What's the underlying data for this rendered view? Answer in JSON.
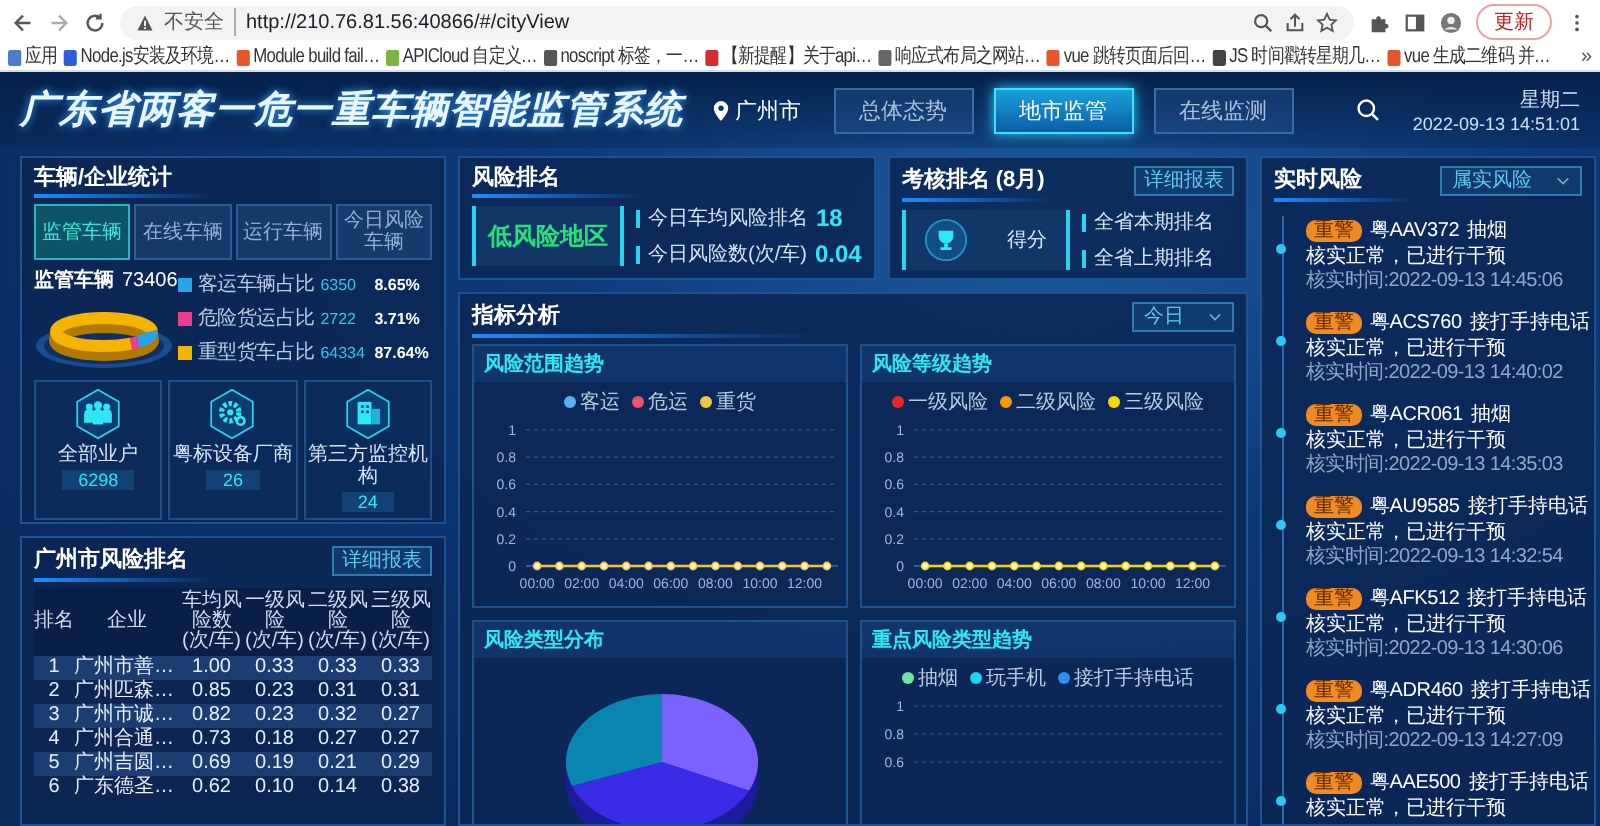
{
  "browser": {
    "security": "不安全",
    "url": "http://210.76.81.56:40866/#/cityView",
    "update_button": "更新"
  },
  "bookmarks": [
    {
      "label": "应用",
      "color": "#4a7bd0"
    },
    {
      "label": "Node.js安装及环境…",
      "color": "#2b5fd9"
    },
    {
      "label": "Module build fail…",
      "color": "#e8542c"
    },
    {
      "label": "APICloud 自定义…",
      "color": "#7cb342"
    },
    {
      "label": "noscript 标签，一…",
      "color": "#555555"
    },
    {
      "label": "【新提醒】关于api…",
      "color": "#d32f2f"
    },
    {
      "label": "响应式布局之网站…",
      "color": "#666666"
    },
    {
      "label": "vue 跳转页面后回…",
      "color": "#e8542d"
    },
    {
      "label": "JS 时间戳转星期几…",
      "color": "#444444"
    },
    {
      "label": "vue 生成二维码 并…",
      "color": "#e8542e"
    }
  ],
  "bookmarks_more": "»",
  "header": {
    "title": "广东省两客一危一重车辆智能监管系统",
    "location": "广州市",
    "nav": [
      {
        "label": "总体态势",
        "selected": false
      },
      {
        "label": "地市监管",
        "selected": true
      },
      {
        "label": "在线监测",
        "selected": false
      }
    ],
    "weekday": "星期二",
    "datetime": "2022-09-13 14:51:01"
  },
  "vehicle_stats": {
    "title": "车辆/企业统计",
    "tabs": [
      {
        "label": "监管车辆",
        "selected": true
      },
      {
        "label": "在线车辆",
        "selected": false
      },
      {
        "label": "运行车辆",
        "selected": false
      },
      {
        "label": "今日风险车辆",
        "selected": false
      }
    ],
    "total_label": "监管车辆",
    "total_value": "73406",
    "legend": [
      {
        "label": "客运车辆占比",
        "count": "6350",
        "percent": "8.65%",
        "color": "#29a3ec"
      },
      {
        "label": "危险货运占比",
        "count": "2722",
        "percent": "3.71%",
        "color": "#e83e8c"
      },
      {
        "label": "重型货车占比",
        "count": "64334",
        "percent": "87.64%",
        "color": "#f5b400"
      }
    ],
    "cards": [
      {
        "kind": "people",
        "label": "全部业户",
        "value": "6298"
      },
      {
        "kind": "gear",
        "label": "粤标设备厂商",
        "value": "26"
      },
      {
        "kind": "building",
        "label": "第三方监控机构",
        "value": "24"
      }
    ]
  },
  "city_ranking": {
    "title": "广州市风险排名",
    "report_button": "详细报表",
    "columns": [
      {
        "label": "排名"
      },
      {
        "label": "企业"
      },
      {
        "label": "车均风险数",
        "unit": "(次/车)"
      },
      {
        "label": "一级风险",
        "unit": "(次/车)"
      },
      {
        "label": "二级风险",
        "unit": "(次/车)"
      },
      {
        "label": "三级风险",
        "unit": "(次/车)"
      }
    ],
    "rows": [
      [
        "1",
        "广州市善…",
        "1.00",
        "0.33",
        "0.33",
        "0.33"
      ],
      [
        "2",
        "广州匹森…",
        "0.85",
        "0.23",
        "0.31",
        "0.31"
      ],
      [
        "3",
        "广州市诚…",
        "0.82",
        "0.23",
        "0.32",
        "0.27"
      ],
      [
        "4",
        "广州合通…",
        "0.73",
        "0.18",
        "0.27",
        "0.27"
      ],
      [
        "5",
        "广州吉圆…",
        "0.69",
        "0.19",
        "0.21",
        "0.29"
      ],
      [
        "6",
        "广东德圣…",
        "0.62",
        "0.10",
        "0.14",
        "0.38"
      ]
    ]
  },
  "risk_rank": {
    "title": "风险排名",
    "level": "低风险地区",
    "stats": [
      {
        "label": "今日车均风险排名",
        "value": "18"
      },
      {
        "label": "今日风险数(次/车)",
        "value": "0.04"
      }
    ]
  },
  "assessment": {
    "title": "考核排名 (8月)",
    "report_button": "详细报表",
    "score_label": "得分",
    "stats": [
      "全省本期排名",
      "全省上期排名"
    ]
  },
  "indicators": {
    "title": "指标分析",
    "period": "今日",
    "charts": [
      {
        "kind": "line",
        "title": "风险范围趋势",
        "chart_data": {
          "type": "line",
          "grid": true,
          "xlim": [
            -0.5,
            13.5
          ],
          "x": [
            0,
            1,
            2,
            3,
            4,
            5,
            6,
            7,
            8,
            9,
            10,
            11,
            12,
            13
          ],
          "xticks": [
            {
              "value": 0,
              "label": "00:00"
            },
            {
              "value": 2,
              "label": "02:00"
            },
            {
              "value": 4,
              "label": "04:00"
            },
            {
              "value": 6,
              "label": "06:00"
            },
            {
              "value": 8,
              "label": "08:00"
            },
            {
              "value": 10,
              "label": "10:00"
            },
            {
              "value": 12,
              "label": "12:00"
            }
          ],
          "ylim": [
            0,
            1
          ],
          "yticks": [
            0,
            0.2,
            0.4,
            0.6,
            0.8,
            1
          ],
          "series": [
            {
              "name": "客运",
              "color": "#5ab1ef",
              "values": [
                null,
                null,
                null,
                null,
                null,
                null,
                null,
                null,
                null,
                null,
                null,
                null,
                null,
                null
              ]
            },
            {
              "name": "危运",
              "color": "#e8566b",
              "values": [
                null,
                null,
                null,
                null,
                null,
                null,
                null,
                null,
                null,
                null,
                null,
                null,
                null,
                null
              ]
            },
            {
              "name": "重货",
              "color": "#f5c342",
              "marker": true,
              "values": [
                0,
                0,
                0,
                0,
                0,
                0,
                0,
                0,
                0,
                0,
                0,
                0,
                0,
                0
              ]
            }
          ]
        }
      },
      {
        "kind": "line",
        "title": "风险等级趋势",
        "chart_data": {
          "type": "line",
          "grid": true,
          "xlim": [
            -0.5,
            13.5
          ],
          "x": [
            0,
            1,
            2,
            3,
            4,
            5,
            6,
            7,
            8,
            9,
            10,
            11,
            12,
            13
          ],
          "xticks": [
            {
              "value": 0,
              "label": "00:00"
            },
            {
              "value": 2,
              "label": "02:00"
            },
            {
              "value": 4,
              "label": "04:00"
            },
            {
              "value": 6,
              "label": "06:00"
            },
            {
              "value": 8,
              "label": "08:00"
            },
            {
              "value": 10,
              "label": "10:00"
            },
            {
              "value": 12,
              "label": "12:00"
            }
          ],
          "ylim": [
            0,
            1
          ],
          "yticks": [
            0,
            0.2,
            0.4,
            0.6,
            0.8,
            1
          ],
          "series": [
            {
              "name": "一级风险",
              "color": "#e8262a",
              "values": [
                null,
                null,
                null,
                null,
                null,
                null,
                null,
                null,
                null,
                null,
                null,
                null,
                null,
                null
              ]
            },
            {
              "name": "二级风险",
              "color": "#f59a00",
              "values": [
                null,
                null,
                null,
                null,
                null,
                null,
                null,
                null,
                null,
                null,
                null,
                null,
                null,
                null
              ]
            },
            {
              "name": "三级风险",
              "color": "#f5d800",
              "marker": true,
              "values": [
                0,
                0,
                0,
                0,
                0,
                0,
                0,
                0,
                0,
                0,
                0,
                0,
                0,
                0
              ]
            }
          ]
        }
      },
      {
        "kind": "pie",
        "title": "风险类型分布"
      },
      {
        "kind": "empty_axes",
        "title": "重点风险类型趋势",
        "legend": [
          {
            "name": "抽烟",
            "color": "#6ee6a0"
          },
          {
            "name": "玩手机",
            "color": "#1ad6f0"
          },
          {
            "name": "接打手持电话",
            "color": "#2f8ff5"
          }
        ],
        "y_labels": [
          "1",
          "0.8",
          "0.6"
        ]
      }
    ]
  },
  "realtime": {
    "title": "实时风险",
    "filter": "属实风险",
    "items": [
      {
        "tag": "重警",
        "plate": "粤AAV372",
        "behavior": "抽烟",
        "status": "核实正常，已进行干预",
        "time": "核实时间:2022-09-13 14:45:06"
      },
      {
        "tag": "重警",
        "plate": "粤ACS760",
        "behavior": "接打手持电话",
        "status": "核实正常，已进行干预",
        "time": "核实时间:2022-09-13 14:40:02"
      },
      {
        "tag": "重警",
        "plate": "粤ACR061",
        "behavior": "抽烟",
        "status": "核实正常，已进行干预",
        "time": "核实时间:2022-09-13 14:35:03"
      },
      {
        "tag": "重警",
        "plate": "粤AU9585",
        "behavior": "接打手持电话",
        "status": "核实正常，已进行干预",
        "time": "核实时间:2022-09-13 14:32:54"
      },
      {
        "tag": "重警",
        "plate": "粤AFK512",
        "behavior": "接打手持电话",
        "status": "核实正常，已进行干预",
        "time": "核实时间:2022-09-13 14:30:06"
      },
      {
        "tag": "重警",
        "plate": "粤ADR460",
        "behavior": "接打手持电话",
        "status": "核实正常，已进行干预",
        "time": "核实时间:2022-09-13 14:27:09"
      },
      {
        "tag": "重警",
        "plate": "粤AAE500",
        "behavior": "接打手持电话",
        "status": "核实正常，已进行干预"
      }
    ]
  }
}
